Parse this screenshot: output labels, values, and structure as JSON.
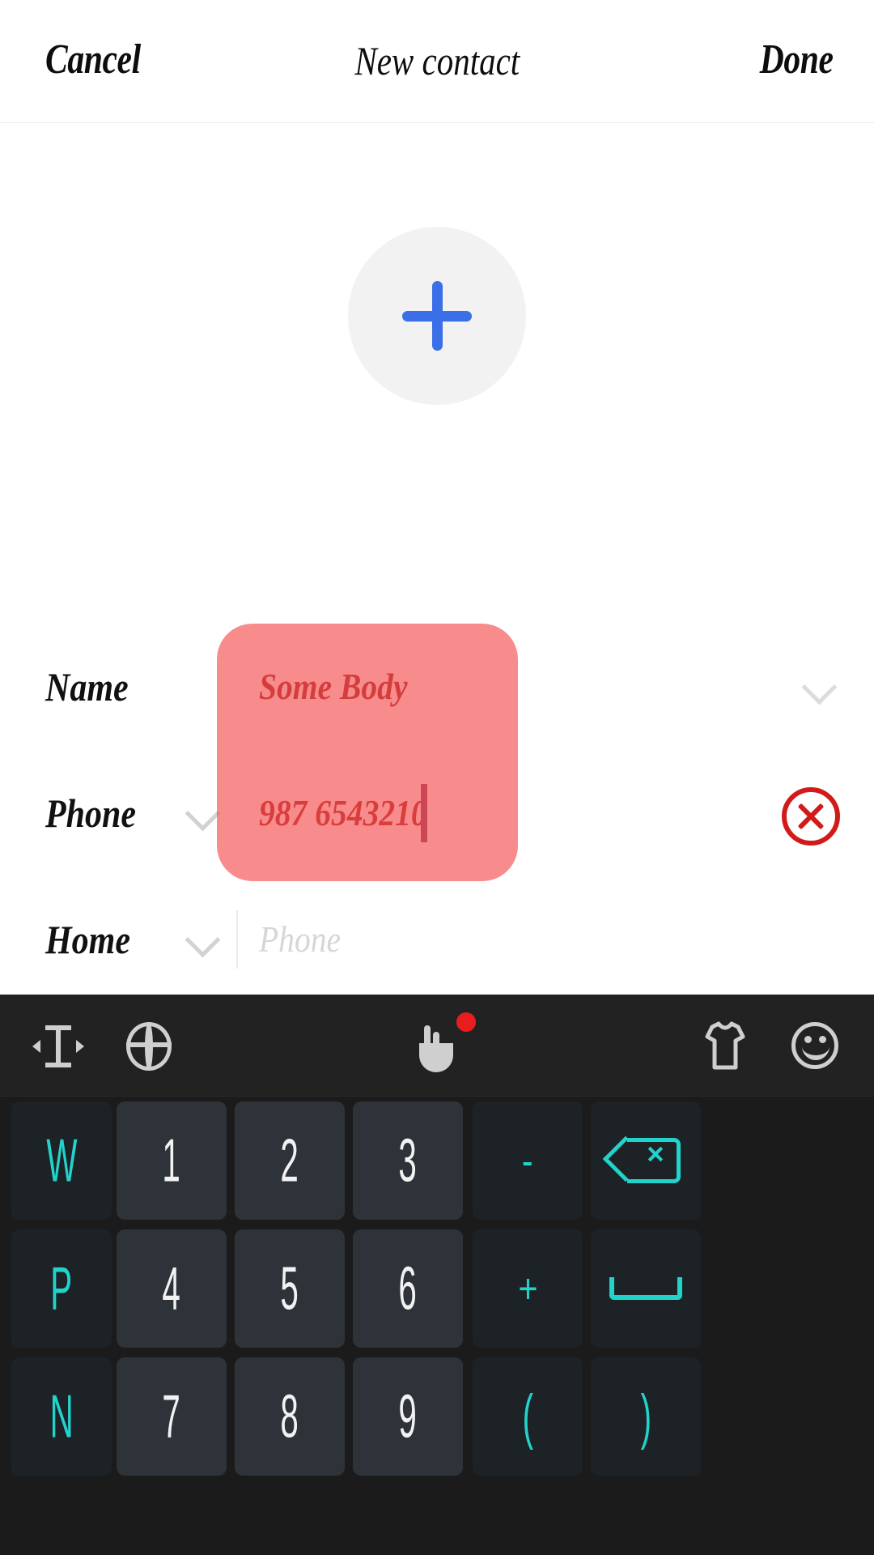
{
  "header": {
    "cancel_label": "Cancel",
    "title": "New contact",
    "done_label": "Done"
  },
  "avatar": {
    "add_photo_icon": "plus-icon",
    "plus_color": "#3b6fe8",
    "circle_color": "#f2f2f2"
  },
  "form": {
    "rows": [
      {
        "label": "Name",
        "value": "Some Body",
        "placeholder": "",
        "has_left_chevron": false,
        "has_right_chevron": true,
        "has_clear": false
      },
      {
        "label": "Phone",
        "value": "987 6543210",
        "placeholder": "",
        "has_left_chevron": true,
        "has_right_chevron": false,
        "has_clear": true
      },
      {
        "label": "Home",
        "value": "",
        "placeholder": "Phone",
        "has_left_chevron": true,
        "has_right_chevron": false,
        "has_clear": false
      }
    ],
    "selection_overlay_color": "#f44646",
    "caret_color": "#8a4a72",
    "clear_icon_color": "#d11a1a"
  },
  "keyboard": {
    "toolbar": [
      {
        "icon": "cursor-move-icon",
        "badge": false
      },
      {
        "icon": "globe-icon",
        "badge": false
      },
      {
        "icon": "hand-gesture-icon",
        "badge": true
      },
      {
        "icon": "tshirt-theme-icon",
        "badge": false
      },
      {
        "icon": "emoji-icon",
        "badge": false
      }
    ],
    "badge_color": "#e81e1e",
    "accent_color": "#22d3cb",
    "rows": [
      [
        {
          "label": "W",
          "type": "fn",
          "color": "cyan",
          "icon": null
        },
        {
          "label": "1",
          "type": "num",
          "color": "white",
          "icon": null
        },
        {
          "label": "2",
          "type": "num",
          "color": "white",
          "icon": null
        },
        {
          "label": "3",
          "type": "num",
          "color": "white",
          "icon": null
        },
        {
          "label": "-",
          "type": "fn",
          "color": "cyan",
          "icon": null
        },
        {
          "label": "",
          "type": "fn",
          "color": "cyan",
          "icon": "backspace-icon"
        }
      ],
      [
        {
          "label": "P",
          "type": "fn",
          "color": "cyan",
          "icon": null
        },
        {
          "label": "4",
          "type": "num",
          "color": "white",
          "icon": null
        },
        {
          "label": "5",
          "type": "num",
          "color": "white",
          "icon": null
        },
        {
          "label": "6",
          "type": "num",
          "color": "white",
          "icon": null
        },
        {
          "label": "+",
          "type": "fn",
          "color": "cyan",
          "icon": null
        },
        {
          "label": "",
          "type": "fn",
          "color": "cyan",
          "icon": "space-icon"
        }
      ],
      [
        {
          "label": "N",
          "type": "fn",
          "color": "cyan",
          "icon": null
        },
        {
          "label": "7",
          "type": "num",
          "color": "white",
          "icon": null
        },
        {
          "label": "8",
          "type": "num",
          "color": "white",
          "icon": null
        },
        {
          "label": "9",
          "type": "num",
          "color": "white",
          "icon": null
        },
        {
          "label": "(",
          "type": "fn",
          "color": "cyan",
          "icon": null
        },
        {
          "label": ")",
          "type": "fn",
          "color": "cyan",
          "icon": null
        }
      ]
    ]
  }
}
